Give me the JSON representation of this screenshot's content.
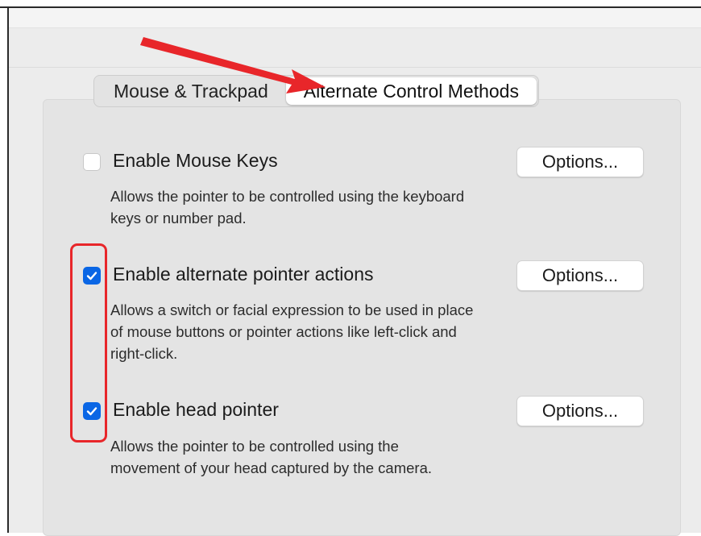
{
  "tabs": [
    {
      "label": "Mouse & Trackpad",
      "active": false
    },
    {
      "label": "Alternate Control Methods",
      "active": true
    }
  ],
  "options": [
    {
      "label": "Enable Mouse Keys",
      "checked": false,
      "button": "Options...",
      "description_lines": [
        "Allows the pointer to be controlled using the keyboard",
        "keys or number pad."
      ]
    },
    {
      "label": "Enable alternate pointer actions",
      "checked": true,
      "button": "Options...",
      "description_lines": [
        "Allows a switch or facial expression to be used in place",
        "of mouse buttons or pointer actions like left-click and",
        "right-click."
      ]
    },
    {
      "label": "Enable head pointer",
      "checked": true,
      "button": "Options...",
      "description_lines": [
        "Allows the pointer to be controlled using the",
        "movement of your head captured by the camera."
      ]
    }
  ],
  "colors": {
    "accent": "#0a66e5",
    "annotation": "#e8262a"
  },
  "icons": {
    "checkmark": "checkmark-icon",
    "arrow": "annotation-arrow"
  }
}
